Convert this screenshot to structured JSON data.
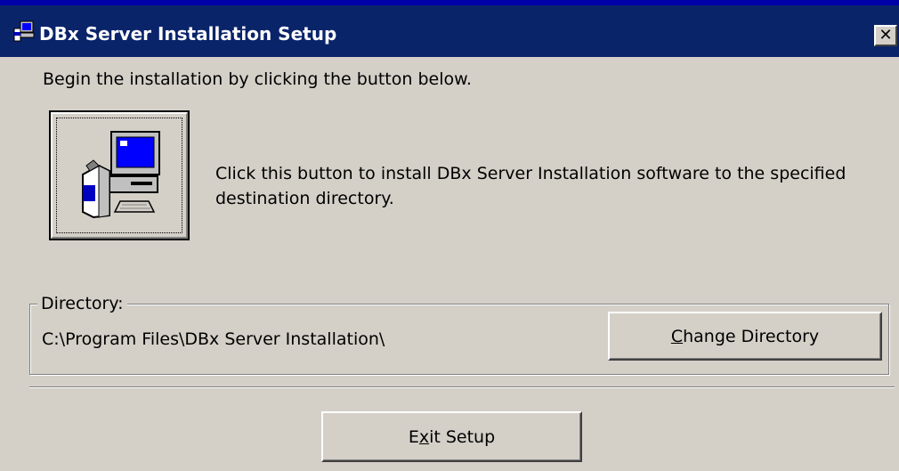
{
  "window": {
    "title": "DBx Server Installation Setup",
    "close_symbol": "✕",
    "title_icon": "setup-computer-icon"
  },
  "intro_text": "Begin the installation by clicking the button below.",
  "install": {
    "icon": "setup-computer-icon",
    "description": "Click this button to install DBx Server Installation software to the specified destination directory."
  },
  "directory": {
    "group_label": "Directory:",
    "path": "C:\\Program Files\\DBx Server Installation\\",
    "change_button": {
      "mnemonic": "C",
      "rest": "hange Directory"
    }
  },
  "exit_button": {
    "before": "E",
    "mnemonic": "x",
    "rest": "it Setup"
  },
  "colors": {
    "titlebar": "#0a246a",
    "face": "#d4d0c8",
    "title_text": "#ffffff"
  }
}
